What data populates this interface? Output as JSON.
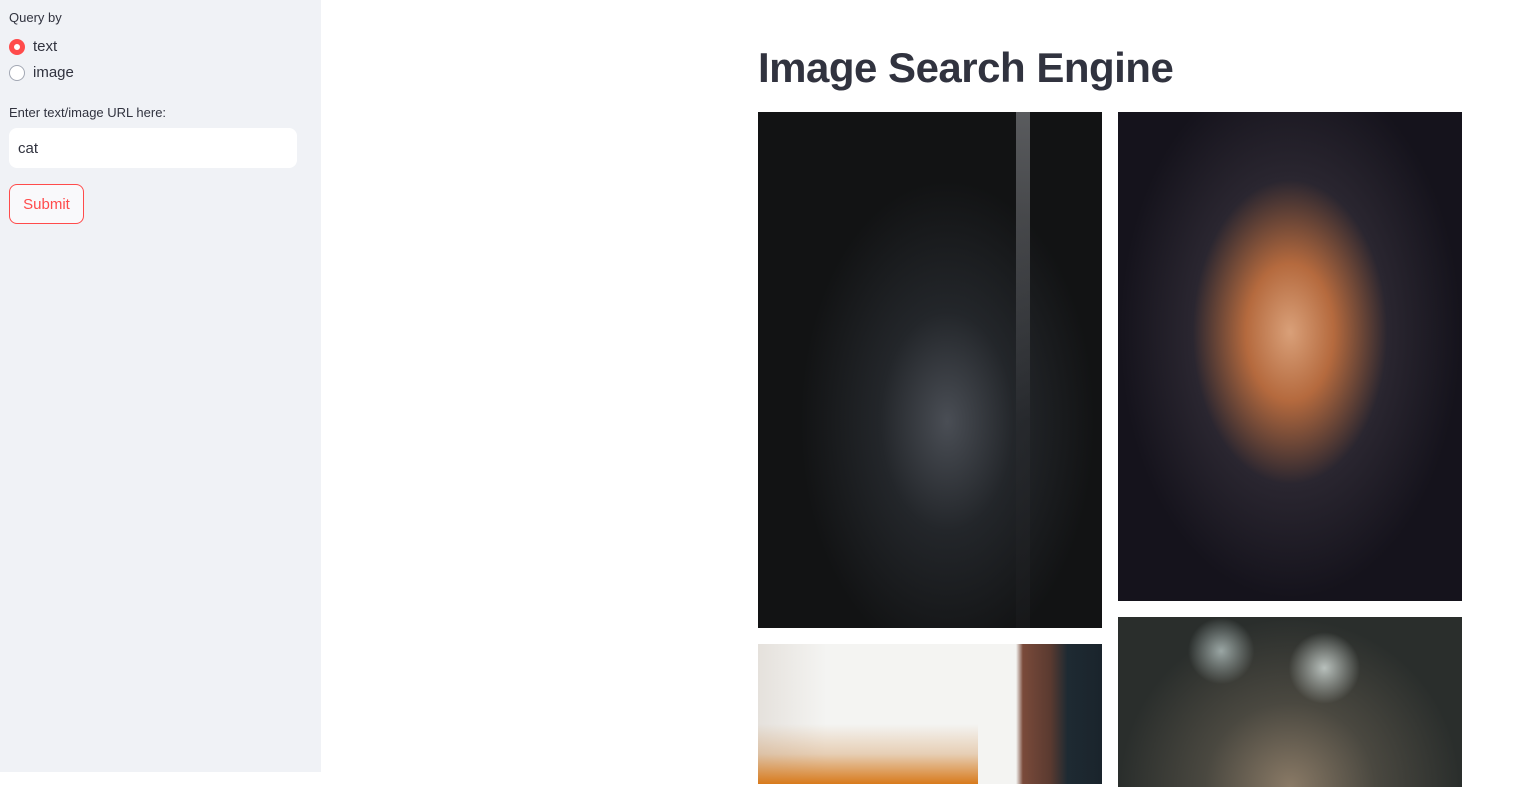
{
  "sidebar": {
    "query_label": "Query by",
    "options": [
      {
        "label": "text",
        "selected": true
      },
      {
        "label": "image",
        "selected": false
      }
    ],
    "input_label": "Enter text/image URL here:",
    "input_value": "cat",
    "submit_label": "Submit",
    "accent": "#ff4b4b"
  },
  "main": {
    "title": "Image Search Engine",
    "results": [
      "dark grey cat",
      "orange fluffy cat",
      "cat near fire",
      "cat ears"
    ]
  }
}
